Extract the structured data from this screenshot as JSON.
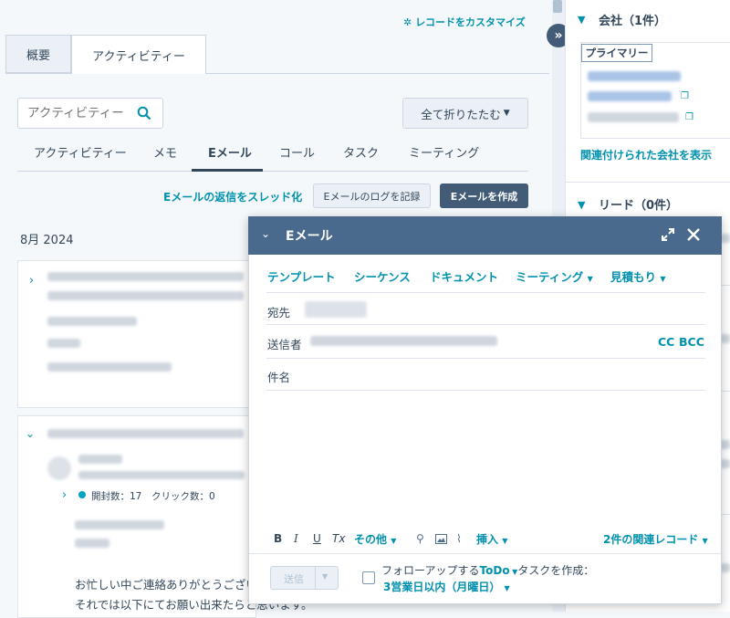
{
  "left": {
    "customize_link": "レコードをカスタマイズ",
    "tabs": [
      "概要",
      "アクティビティー"
    ],
    "search_placeholder": "アクティビティー",
    "collapse_all": "全て折りたたむ",
    "subtabs": [
      "アクティビティー",
      "メモ",
      "Eメール",
      "コール",
      "タスク",
      "ミーティング"
    ],
    "active_subtab": "Eメール",
    "thread_link": "Eメールの返信をスレッド化",
    "log_email": "Eメールのログを記録",
    "create_email": "Eメールを作成",
    "month": "8月 2024",
    "opens": "開封数：17",
    "clicks": "クリック数：0",
    "body_line1": "お忙しい中ご連絡ありがとうござい",
    "body_line2": "それでは以下にてお願い出来たらと思います。"
  },
  "right": {
    "company_title": "会社（1件）",
    "primary_badge": "プライマリー",
    "related_link": "関連付けられた会社を表示",
    "lead_title": "リード（0件）"
  },
  "email": {
    "title": "Eメール",
    "toolbar": [
      "テンプレート",
      "シーケンス",
      "ドキュメント",
      "ミーティング",
      "見積もり"
    ],
    "to_label": "宛先",
    "from_label": "送信者",
    "cc": "CC",
    "bcc": "BCC",
    "subject_label": "件名",
    "format": {
      "bold": "B",
      "italic": "I",
      "underline": "U",
      "clear": "Tx",
      "more": "その他",
      "insert": "挿入"
    },
    "related_records": "2件の関連レコード",
    "send": "送信",
    "followup_prefix": "フォローアップする",
    "followup_type": "ToDo",
    "followup_suffix": "タスクを作成：",
    "followup_due": "3営業日以内（月曜日）"
  },
  "colors": {
    "accent": "#0091ae",
    "header": "#4a6a8d",
    "dark_button": "#425b76"
  }
}
